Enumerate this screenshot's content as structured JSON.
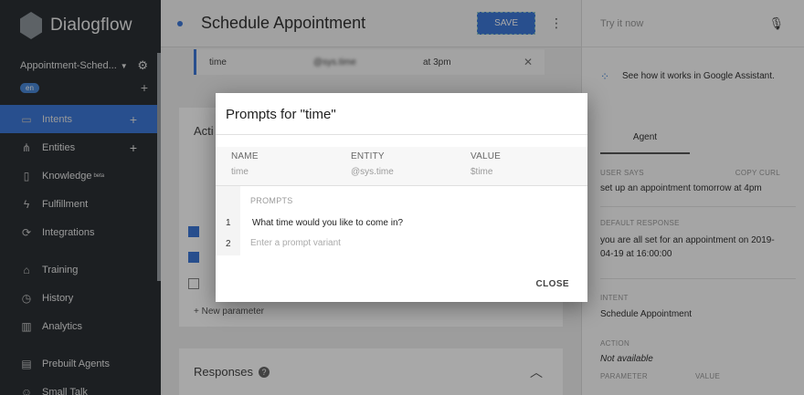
{
  "sidebar": {
    "logo_text": "Dialogflow",
    "agent_name": "Appointment-Sched...",
    "language_badge": "en",
    "items": [
      {
        "label": "Intents",
        "icon": "chat-icon",
        "has_add": true
      },
      {
        "label": "Entities",
        "icon": "sitemap-icon",
        "has_add": true
      },
      {
        "label": "Knowledge",
        "label_sup": "beta",
        "icon": "book-icon"
      },
      {
        "label": "Fulfillment",
        "icon": "bolt-icon"
      },
      {
        "label": "Integrations",
        "icon": "sync-icon"
      },
      {
        "label": "Training",
        "icon": "graduation-cap-icon"
      },
      {
        "label": "History",
        "icon": "clock-icon"
      },
      {
        "label": "Analytics",
        "icon": "chart-icon"
      },
      {
        "label": "Prebuilt Agents",
        "icon": "list-icon"
      },
      {
        "label": "Small Talk",
        "icon": "smile-icon"
      }
    ]
  },
  "header": {
    "intent_title": "Schedule Appointment",
    "save_label": "SAVE"
  },
  "param_row": {
    "name": "time",
    "entity": "@sys.time",
    "value": "at 3pm"
  },
  "actions": {
    "heading": "Acti",
    "new_parameter": "+ New parameter"
  },
  "responses": {
    "heading": "Responses"
  },
  "right_panel": {
    "try_placeholder": "Try it now",
    "ga_link": "See how it works in Google Assistant.",
    "tab": "Agent",
    "user_says_label": "USER SAYS",
    "copy_curl_label": "COPY CURL",
    "user_says": "set up an appointment tomorrow at 4pm",
    "default_response_label": "DEFAULT RESPONSE",
    "default_response": "you are all set for an appointment on 2019-04-19 at 16:00:00",
    "intent_label": "INTENT",
    "intent_value": "Schedule Appointment",
    "action_label": "ACTION",
    "action_value": "Not available",
    "parameter_label": "PARAMETER",
    "value_label": "VALUE"
  },
  "modal": {
    "title": "Prompts for \"time\"",
    "columns": [
      {
        "header": "NAME",
        "value": "time"
      },
      {
        "header": "ENTITY",
        "value": "@sys.time"
      },
      {
        "header": "VALUE",
        "value": "$time"
      }
    ],
    "prompts_label": "PROMPTS",
    "prompts": [
      {
        "num": "1",
        "text": "What time would you like to come in?"
      }
    ],
    "new_prompt": {
      "num": "2",
      "placeholder": "Enter a prompt variant"
    },
    "close_label": "CLOSE"
  }
}
